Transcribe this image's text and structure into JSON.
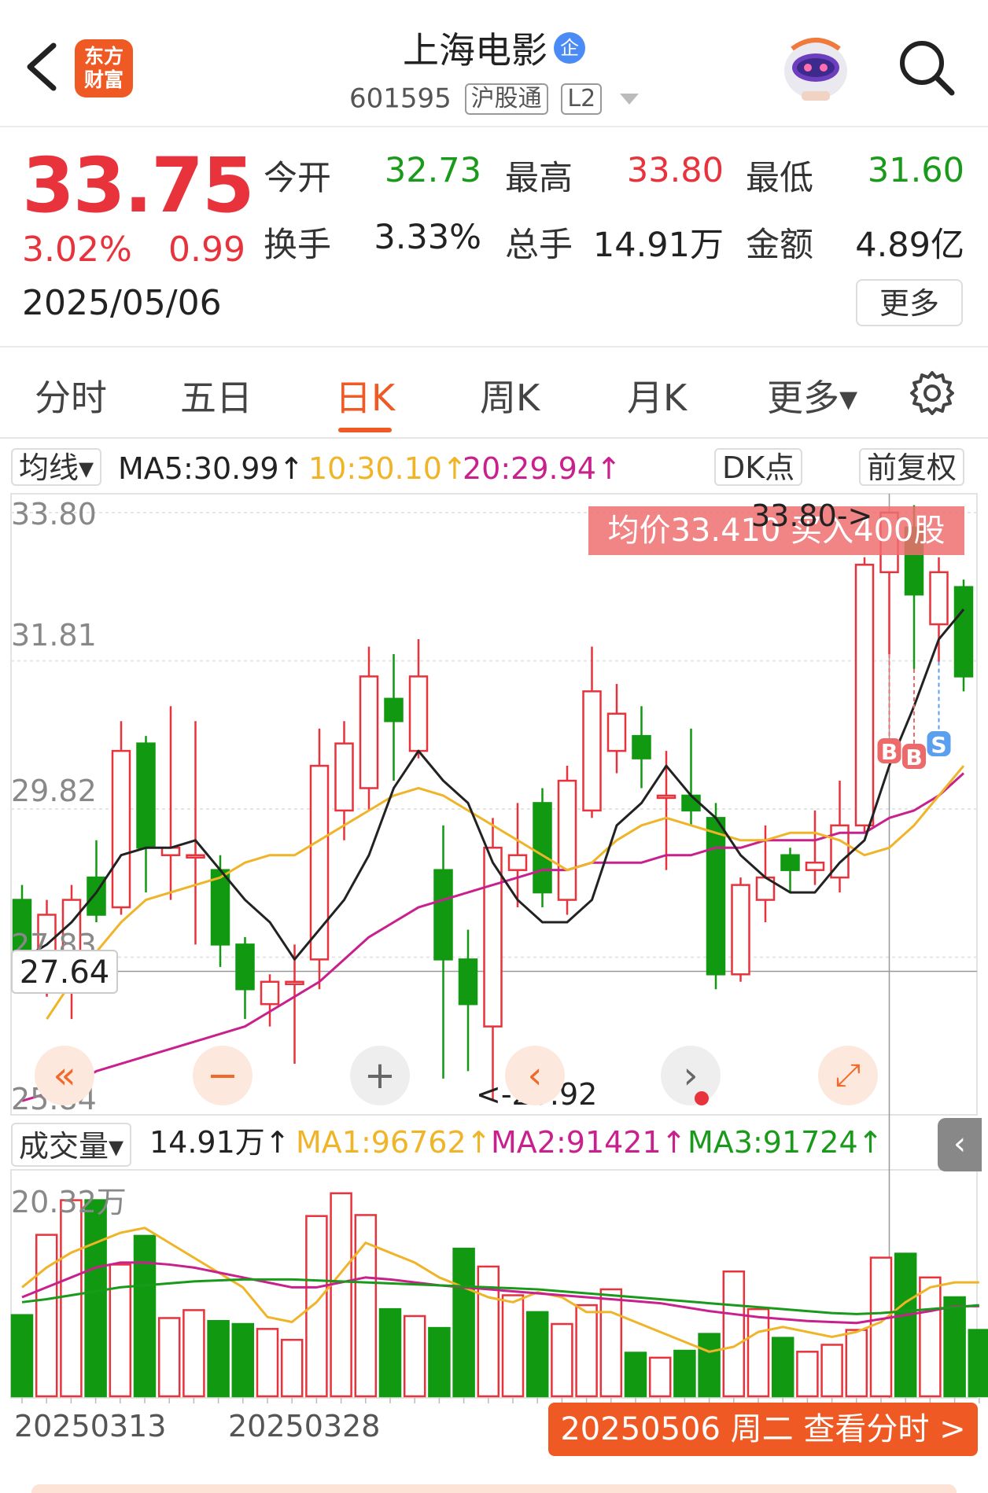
{
  "header": {
    "app_logo_text": "东方\n财富",
    "title": "上海电影",
    "title_badge": "企",
    "code": "601595",
    "tag_hgt": "沪股通",
    "tag_level": "L2"
  },
  "quote": {
    "price": "33.75",
    "change_pct": "3.02%",
    "change": "0.99",
    "date": "2025/05/06",
    "open_label": "今开",
    "open": "32.73",
    "high_label": "最高",
    "high": "33.80",
    "low_label": "最低",
    "low": "31.60",
    "turnover_label": "换手",
    "turnover": "3.33%",
    "volume_label": "总手",
    "volume": "14.91万",
    "amount_label": "金额",
    "amount": "4.89亿",
    "more": "更多"
  },
  "tabs": [
    "分时",
    "五日",
    "日K",
    "周K",
    "月K",
    "更多▾"
  ],
  "active_tab": "日K",
  "ma": {
    "selector": "均线▾",
    "ma5": "MA5:30.99↑",
    "ma10": "10:30.10↑",
    "ma20": "20:29.94↑",
    "dk_btn": "DK点",
    "adjust_btn": "前复权"
  },
  "kline": {
    "y_labels": [
      "33.80",
      "31.81",
      "29.82",
      "27.83",
      "25.84"
    ],
    "last_price_tag": "27.64",
    "avg_tag": "均价33.410  买入400股",
    "high_annotation": "33.80->",
    "low_annotation": "<-25.92",
    "marker_b": "B",
    "marker_s": "S"
  },
  "controls": {
    "first": "«",
    "zoom_out": "−",
    "zoom_in": "+",
    "prev": "‹",
    "next": "›",
    "fullscreen": "⤢"
  },
  "volume": {
    "selector": "成交量▾",
    "value": "14.91万↑",
    "ma1": "MA1:96762↑",
    "ma2": "MA2:91421↑",
    "ma3": "MA3:91724↑",
    "y_label": "20.32万",
    "side_tab": "‹"
  },
  "x_labels": [
    "20250313",
    "20250328"
  ],
  "cta": "20250506 周二 查看分时 >",
  "colors": {
    "up": "#e8323c",
    "down": "#119911",
    "ma5": "#222222",
    "ma10": "#f0b429",
    "ma20": "#c8208c",
    "accent": "#ef5a24"
  },
  "chart_data": {
    "type": "candlestick",
    "candles": [
      {
        "o": 28.6,
        "c": 27.8,
        "h": 28.8,
        "l": 27.6
      },
      {
        "o": 27.5,
        "c": 28.4,
        "h": 28.6,
        "l": 27.3
      },
      {
        "o": 27.4,
        "c": 28.6,
        "h": 28.8,
        "l": 27.0
      },
      {
        "o": 28.9,
        "c": 28.4,
        "h": 29.4,
        "l": 28.3
      },
      {
        "o": 28.5,
        "c": 30.6,
        "h": 31.0,
        "l": 28.4
      },
      {
        "o": 30.7,
        "c": 29.3,
        "h": 30.8,
        "l": 28.7
      },
      {
        "o": 29.2,
        "c": 29.3,
        "h": 31.2,
        "l": 28.6
      },
      {
        "o": 29.2,
        "c": 29.2,
        "h": 31.0,
        "l": 28.0
      },
      {
        "o": 29.0,
        "c": 28.0,
        "h": 29.2,
        "l": 27.7
      },
      {
        "o": 28.0,
        "c": 27.4,
        "h": 28.1,
        "l": 27.0
      },
      {
        "o": 27.2,
        "c": 27.5,
        "h": 27.6,
        "l": 26.9
      },
      {
        "o": 27.5,
        "c": 27.5,
        "h": 28.0,
        "l": 26.4
      },
      {
        "o": 27.8,
        "c": 30.4,
        "h": 30.9,
        "l": 27.4
      },
      {
        "o": 29.8,
        "c": 30.7,
        "h": 31.0,
        "l": 29.4
      },
      {
        "o": 30.1,
        "c": 31.6,
        "h": 32.0,
        "l": 29.8
      },
      {
        "o": 31.3,
        "c": 31.0,
        "h": 31.9,
        "l": 30.2
      },
      {
        "o": 30.6,
        "c": 31.6,
        "h": 32.1,
        "l": 30.5
      },
      {
        "o": 29.0,
        "c": 27.8,
        "h": 29.6,
        "l": 26.2
      },
      {
        "o": 27.8,
        "c": 27.2,
        "h": 28.2,
        "l": 26.3
      },
      {
        "o": 26.9,
        "c": 29.3,
        "h": 29.7,
        "l": 25.92
      },
      {
        "o": 29.0,
        "c": 29.2,
        "h": 29.9,
        "l": 28.5
      },
      {
        "o": 29.9,
        "c": 28.7,
        "h": 30.1,
        "l": 28.5
      },
      {
        "o": 28.6,
        "c": 30.2,
        "h": 30.4,
        "l": 28.4
      },
      {
        "o": 29.8,
        "c": 31.4,
        "h": 32.0,
        "l": 29.7
      },
      {
        "o": 30.6,
        "c": 31.1,
        "h": 31.5,
        "l": 30.3
      },
      {
        "o": 30.8,
        "c": 30.5,
        "h": 31.2,
        "l": 30.1
      },
      {
        "o": 30.0,
        "c": 30.0,
        "h": 30.6,
        "l": 29.0
      },
      {
        "o": 30.0,
        "c": 29.8,
        "h": 30.9,
        "l": 29.6
      },
      {
        "o": 29.7,
        "c": 27.6,
        "h": 29.9,
        "l": 27.4
      },
      {
        "o": 27.6,
        "c": 28.8,
        "h": 28.9,
        "l": 27.5
      },
      {
        "o": 28.6,
        "c": 28.9,
        "h": 29.6,
        "l": 28.3
      },
      {
        "o": 29.2,
        "c": 29.0,
        "h": 29.3,
        "l": 28.7
      },
      {
        "o": 29.0,
        "c": 29.1,
        "h": 29.8,
        "l": 28.8
      },
      {
        "o": 28.9,
        "c": 29.6,
        "h": 30.2,
        "l": 28.7
      },
      {
        "o": 29.6,
        "c": 33.1,
        "h": 33.2,
        "l": 29.5
      },
      {
        "o": 33.0,
        "c": 33.8,
        "h": 33.8,
        "l": 31.9
      },
      {
        "o": 33.6,
        "c": 32.7,
        "h": 33.9,
        "l": 31.7
      },
      {
        "o": 32.3,
        "c": 33.0,
        "h": 33.2,
        "l": 31.8
      },
      {
        "o": 32.8,
        "c": 31.6,
        "h": 32.9,
        "l": 31.4
      }
    ],
    "ma5": [
      27.8,
      28.0,
      28.3,
      28.7,
      29.2,
      29.3,
      29.3,
      29.4,
      29.0,
      28.6,
      28.3,
      27.8,
      28.2,
      28.6,
      29.2,
      30.1,
      30.6,
      30.2,
      29.9,
      29.1,
      28.6,
      28.3,
      28.3,
      28.6,
      29.6,
      29.9,
      30.4,
      30.0,
      29.7,
      29.2,
      28.9,
      28.7,
      28.7,
      29.1,
      29.4,
      30.4,
      31.2,
      32.1,
      32.5
    ],
    "ma10": [
      null,
      27.0,
      27.5,
      27.9,
      28.3,
      28.6,
      28.7,
      28.8,
      28.9,
      29.1,
      29.2,
      29.2,
      29.4,
      29.6,
      29.8,
      30.0,
      30.1,
      30.0,
      29.8,
      29.6,
      29.4,
      29.2,
      29.0,
      29.1,
      29.4,
      29.6,
      29.7,
      29.6,
      29.5,
      29.4,
      29.4,
      29.5,
      29.5,
      29.4,
      29.2,
      29.3,
      29.6,
      30.0,
      30.4
    ],
    "ma20": [
      25.9,
      26.0,
      26.1,
      26.3,
      26.4,
      26.5,
      26.6,
      26.7,
      26.8,
      26.9,
      27.1,
      27.3,
      27.5,
      27.8,
      28.1,
      28.3,
      28.5,
      28.6,
      28.7,
      28.8,
      28.9,
      29.0,
      29.0,
      29.1,
      29.1,
      29.1,
      29.2,
      29.2,
      29.3,
      29.3,
      29.4,
      29.4,
      29.4,
      29.5,
      29.5,
      29.7,
      29.8,
      30.0,
      30.3
    ],
    "volumes": [
      8.2,
      16.3,
      19.8,
      19.8,
      13.3,
      16.2,
      7.9,
      8.7,
      7.6,
      7.3,
      6.8,
      5.7,
      18.2,
      20.5,
      18.3,
      8.8,
      8.1,
      6.9,
      14.9,
      13.1,
      10.2,
      8.5,
      7.3,
      9.2,
      10.8,
      4.4,
      3.9,
      4.6,
      6.3,
      12.6,
      8.8,
      5.9,
      4.5,
      5.2,
      6.7,
      14.0,
      14.4,
      12.0,
      10.0,
      6.7
    ],
    "vol_ma1": [
      11.0,
      13.0,
      14.5,
      15.5,
      16.5,
      17.0,
      15.5,
      14.0,
      12.5,
      11.0,
      8.0,
      7.5,
      9.5,
      12.5,
      15.5,
      14.5,
      13.5,
      12.0,
      11.0,
      10.0,
      9.5,
      10.5,
      10.0,
      8.5,
      8.5,
      7.5,
      6.5,
      5.5,
      4.5,
      5.0,
      6.5,
      7.0,
      6.5,
      6.0,
      6.5,
      7.5,
      9.5,
      11.0,
      11.5,
      11.5
    ],
    "vol_ma2": [
      10.0,
      11.0,
      12.0,
      13.0,
      13.5,
      13.5,
      13.3,
      13.0,
      12.5,
      12.0,
      11.5,
      11.0,
      11.0,
      11.5,
      12.0,
      11.8,
      11.5,
      11.2,
      11.0,
      10.8,
      10.6,
      10.4,
      10.2,
      10.0,
      9.8,
      9.6,
      9.4,
      9.0,
      8.6,
      8.3,
      8.0,
      7.8,
      7.6,
      7.5,
      7.4,
      7.8,
      8.2,
      8.6,
      9.1,
      9.1
    ],
    "vol_ma3": [
      9.5,
      9.8,
      10.2,
      10.6,
      11.0,
      11.2,
      11.4,
      11.6,
      11.7,
      11.8,
      11.8,
      11.8,
      11.7,
      11.6,
      11.5,
      11.4,
      11.3,
      11.2,
      11.1,
      11.0,
      10.9,
      10.8,
      10.6,
      10.4,
      10.2,
      10.0,
      9.8,
      9.6,
      9.4,
      9.2,
      9.0,
      8.8,
      8.6,
      8.4,
      8.3,
      8.4,
      8.6,
      8.8,
      9.0,
      9.2
    ],
    "y_range": [
      25.84,
      33.8
    ],
    "vol_max": 20.32
  }
}
